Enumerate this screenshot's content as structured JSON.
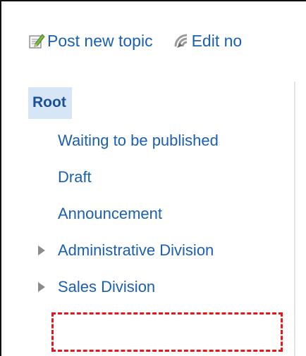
{
  "toolbar": {
    "post_new_topic": "Post new topic",
    "edit_notice": "Edit no",
    "post_icon": "pencil-note-icon",
    "edit_icon": "edit-feed-icon"
  },
  "tree": {
    "root_label": "Root",
    "items": [
      {
        "label": "Waiting to be published",
        "has_children": false
      },
      {
        "label": "Draft",
        "has_children": false
      },
      {
        "label": "Announcement",
        "has_children": false
      },
      {
        "label": "Administrative Division",
        "has_children": true
      },
      {
        "label": "Sales Division",
        "has_children": true
      }
    ]
  },
  "colors": {
    "link": "#1a5fb4",
    "root_highlight": "#d6e6f7",
    "dashed_highlight": "#e8161b"
  }
}
